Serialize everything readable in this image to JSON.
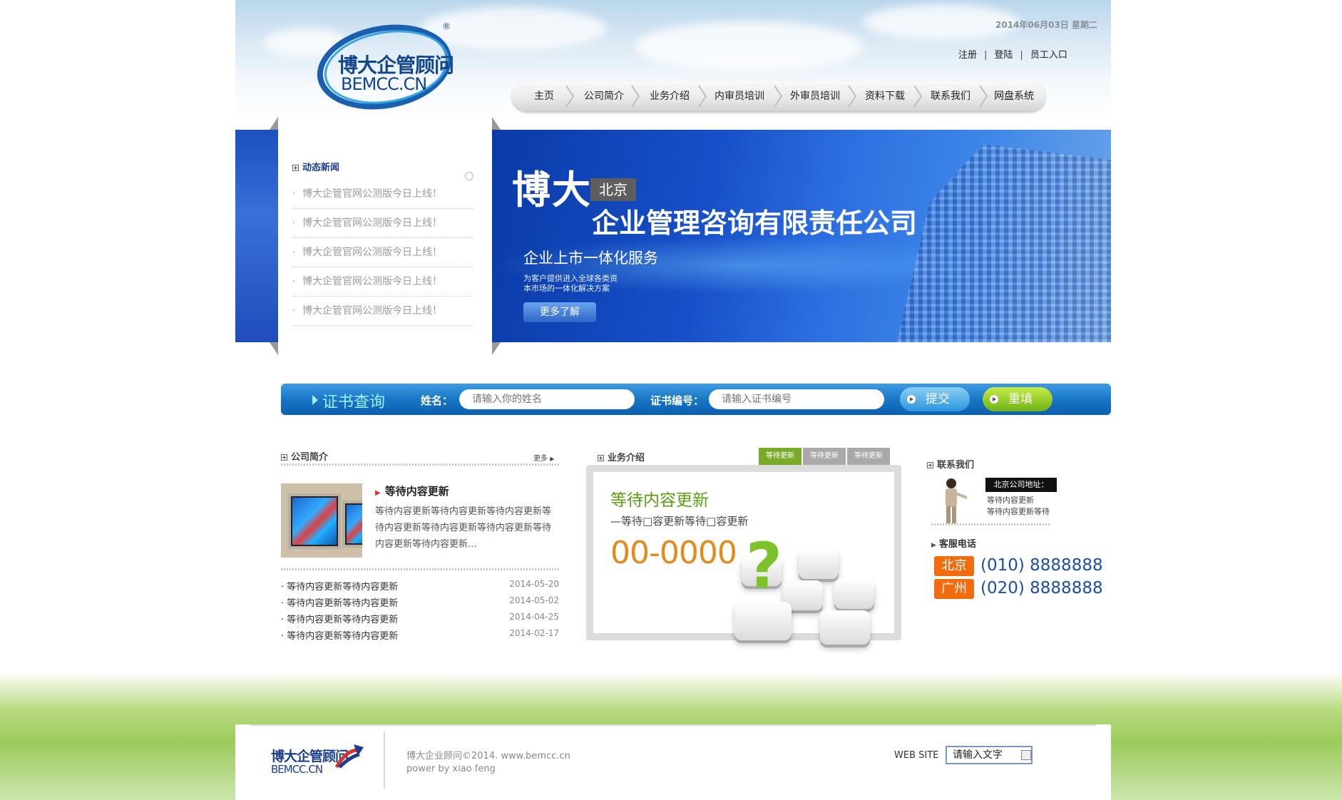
{
  "header": {
    "date": "2014年06月03日  星期二",
    "logo": {
      "cn": "博大企管顾问",
      "en": "BEMCC.CN",
      "reg": "®"
    },
    "links": [
      "注册",
      "登陆",
      "员工入口"
    ]
  },
  "nav": [
    "主页",
    "公司简介",
    "业务介绍",
    "内审员培训",
    "外审员培训",
    "资料下载",
    "联系我们",
    "网盘系统"
  ],
  "news": {
    "title": "动态新闻",
    "items": [
      "博大企管官网公测版今日上线！",
      "博大企管官网公测版今日上线！",
      "博大企管官网公测版今日上线！",
      "博大企管官网公测版今日上线！",
      "博大企管官网公测版今日上线！"
    ]
  },
  "banner": {
    "big": "博大",
    "city": "北京",
    "company": "企业管理咨询有限责任公司",
    "service": "企业上市一体化服务",
    "desc_line1": "为客户提供进入全球各类资",
    "desc_line2": "本市场的一体化解决方案",
    "more": "更多了解"
  },
  "cert": {
    "title": "证书查询",
    "name_label": "姓名：",
    "name_placeholder": "请输入你的姓名",
    "no_label": "证书编号：",
    "no_placeholder": "请输入证书编号",
    "submit": "提交",
    "reset": "重填"
  },
  "intro": {
    "title": "公司简介",
    "more": "更多",
    "headline": "等待内容更新",
    "text": "等待内容更新等待内容更新等待内容更新等待内容更新等待内容更新等待内容更新等待内容更新等待内容更新…",
    "list": [
      {
        "title": "等待内容更新等待内容更新",
        "date": "2014-05-20"
      },
      {
        "title": "等待内容更新等待内容更新",
        "date": "2014-05-02"
      },
      {
        "title": "等待内容更新等待内容更新",
        "date": "2014-04-25"
      },
      {
        "title": "等待内容更新等待内容更新",
        "date": "2014-02-17"
      }
    ]
  },
  "business": {
    "title": "业务介绍",
    "tabs": [
      "等待更新",
      "等待更新",
      "等待更新"
    ],
    "heading": "等待内容更新",
    "sub": "—等待□容更新等待□容更新",
    "number": "00-0000"
  },
  "contact": {
    "title": "联系我们",
    "addr_label": "北京公司地址：",
    "addr_line1": "等待内容更新",
    "addr_line2": "等待内容更新等待",
    "svc_title": "客服电话",
    "phones": [
      {
        "city": "北京",
        "number": "(010) 8888888"
      },
      {
        "city": "广州",
        "number": "(020) 8888888"
      }
    ]
  },
  "footer": {
    "logo_cn": "博大企管顾问",
    "logo_en": "BEMCC.CN",
    "copy1": "博大企业顾问©2014. www.bemcc.cn",
    "copy2": "power by xiao feng",
    "website_label": "WEB SITE",
    "website_input": "请输入文字"
  },
  "colors": {
    "brand_blue": "#1b5fb0",
    "accent_green": "#5c9e12",
    "accent_orange": "#f26b0e",
    "number_orange": "#e48a1c",
    "tab_active": "#7aaa2a",
    "tab_inactive": "#a9a9a9"
  }
}
